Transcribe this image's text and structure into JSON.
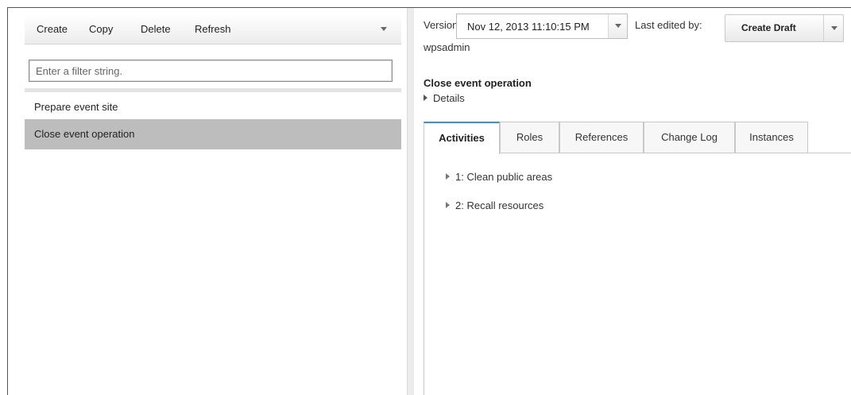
{
  "left_toolbar": {
    "create_label": "Create",
    "copy_label": "Copy",
    "delete_label": "Delete",
    "refresh_label": "Refresh"
  },
  "filter": {
    "placeholder": "Enter a filter string.",
    "value": ""
  },
  "list": {
    "items": [
      {
        "label": "Prepare event site",
        "selected": false
      },
      {
        "label": "Close event operation",
        "selected": true
      }
    ]
  },
  "header": {
    "version_label": "Version:",
    "version_value": "Nov 12, 2013 11:10:15 PM",
    "last_edited_label": "Last edited by:",
    "last_edited_value": "wpsadmin",
    "create_draft_label": "Create Draft"
  },
  "detail": {
    "title": "Close event operation",
    "details_toggle_label": "Details"
  },
  "tabs": [
    {
      "label": "Activities",
      "active": true
    },
    {
      "label": "Roles",
      "active": false
    },
    {
      "label": "References",
      "active": false
    },
    {
      "label": "Change Log",
      "active": false
    },
    {
      "label": "Instances",
      "active": false
    }
  ],
  "activities": [
    {
      "label": "1: Clean public areas"
    },
    {
      "label": "2: Recall resources"
    }
  ],
  "colors": {
    "selected_row": "#bdbdbd",
    "active_tab_accent": "#3b8fd9",
    "frame_border": "#555555"
  },
  "icons": {
    "toolbar_more": "chevron-down-icon",
    "version_dropdown": "chevron-down-icon",
    "create_draft_menu": "chevron-down-icon",
    "expand": "triangle-right-icon"
  }
}
